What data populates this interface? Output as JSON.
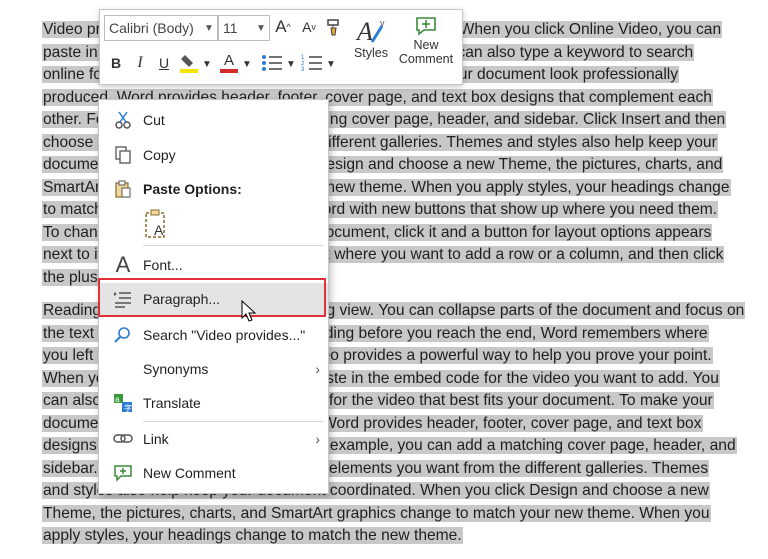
{
  "document": {
    "lines": [
      "Video provides a powerful way to help you prove your point. When you click Online Video, you can",
      "paste in the embed code for the video you want to add. You can also type a keyword to search",
      "online for the video that best fits your document. To make your document look professionally",
      "produced, Word provides header, footer, cover page, and text box designs that complement each",
      "other. For example, you can add a matching cover page, header, and sidebar. Click Insert and then",
      "choose the elements you want from the different galleries. Themes and styles also help keep your",
      "document coordinated. When you click Design and choose a new Theme, the pictures, charts, and",
      "SmartArt graphics change to match your new theme. When you apply styles, your headings change",
      "to match the new theme. Save time in Word with new buttons that show up where you need them.",
      "To change the way a picture fits in your document, click it and a button for layout options appears",
      "next to it. When you work on a table, click where you want to add a row or a column, and then click",
      "the plus sign.",
      "Reading is easier, too, in the new Reading view. You can collapse parts of the document and focus on",
      "the text you want. If you need to stop reading before you reach the end, Word remembers where",
      "you left off - even on another device. Video provides a powerful way to help you prove your point.",
      "When you click Online Video, you can paste in the embed code for the video you want to add. You",
      "can also type a keyword to search online for the video that best fits your document. To make your",
      "document look professionally produced, Word provides header, footer, cover page, and text box",
      "designs that complement each other. For example, you can add a matching cover page, header, and",
      "sidebar. Click Insert and then choose the elements you want from the different galleries. Themes",
      "and styles also help keep your document coordinated. When you click Design and choose a new",
      "Theme, the pictures, charts, and SmartArt graphics change to match your new theme. When you",
      "apply styles, your headings change to match the new theme."
    ]
  },
  "toolbar": {
    "font_name": "Calibri (Body)",
    "font_size": "11",
    "grow_font": "A",
    "shrink_font": "A",
    "bold": "B",
    "italic": "I",
    "underline": "U",
    "font_color_letter": "A",
    "styles_label": "Styles",
    "new_comment_line1": "New",
    "new_comment_line2": "Comment",
    "highlight_color": "#f5e400",
    "font_color": "#d12b2b"
  },
  "context_menu": {
    "cut": "Cut",
    "copy": "Copy",
    "paste_options": "Paste Options:",
    "font": "Font...",
    "paragraph": "Paragraph...",
    "search": "Search \"Video provides...\"",
    "synonyms": "Synonyms",
    "translate": "Translate",
    "link": "Link",
    "new_comment": "New Comment",
    "highlight_border_color": "#e0313a"
  },
  "icons": [
    "cut-icon",
    "copy-icon",
    "paste-icon",
    "font-icon",
    "paragraph-icon",
    "search-icon",
    "translate-icon",
    "link-icon",
    "new-comment-icon",
    "styles-icon",
    "format-painter-icon",
    "bullets-icon",
    "numbering-icon",
    "highlighter-icon"
  ]
}
